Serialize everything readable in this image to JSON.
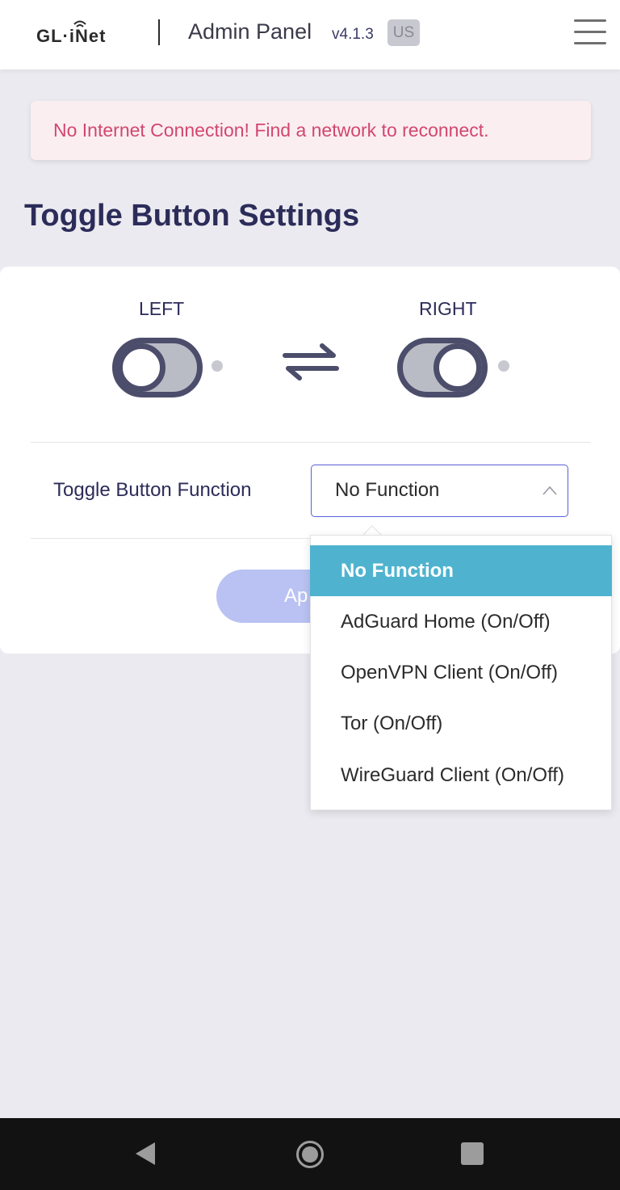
{
  "header": {
    "logo": "GL·iNet",
    "title": "Admin Panel",
    "version": "v4.1.3",
    "region": "US"
  },
  "alert": {
    "text": "No Internet Connection! Find a network to reconnect."
  },
  "page": {
    "title": "Toggle Button Settings"
  },
  "toggle": {
    "left_label": "LEFT",
    "right_label": "RIGHT"
  },
  "field": {
    "label": "Toggle Button Function",
    "value": "No Function"
  },
  "apply_button": {
    "label": "Ap"
  },
  "dropdown": {
    "options": [
      "No Function",
      "AdGuard Home (On/Off)",
      "OpenVPN Client (On/Off)",
      "Tor (On/Off)",
      "WireGuard Client (On/Off)"
    ],
    "selected": "No Function"
  },
  "colors": {
    "accent": "#5a5fd8",
    "selected_option": "#4fb3cf",
    "alert_text": "#d2476e",
    "alert_bg": "#fbeef1"
  },
  "icons": [
    "wifi-logo-icon",
    "hamburger-menu-icon",
    "swap-arrows-icon",
    "chevron-up-icon",
    "back-icon",
    "home-icon",
    "recents-icon"
  ]
}
